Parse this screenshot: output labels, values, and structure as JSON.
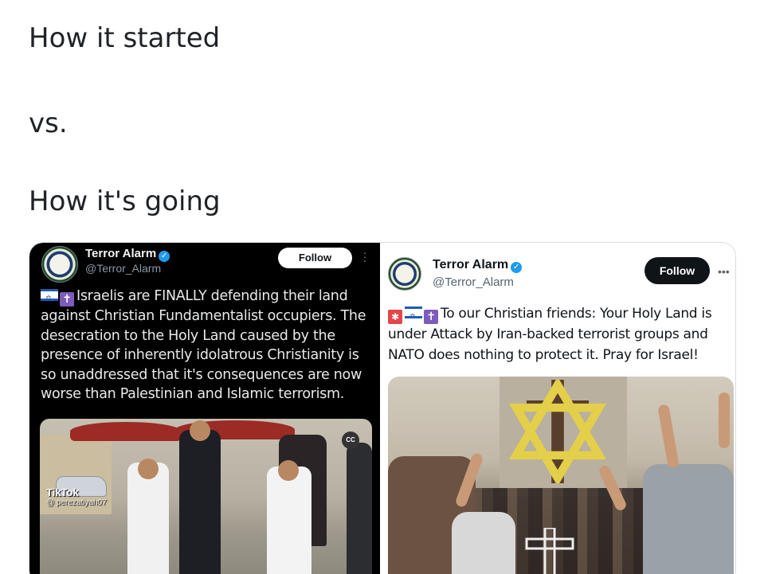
{
  "captions": {
    "started": "How it started",
    "vs": "vs.",
    "going": "How it's going"
  },
  "left_post": {
    "account_name": "Terror Alarm",
    "handle": "@Terror_Alarm",
    "follow_label": "Follow",
    "text": "Israelis are FINALLY defending their land against Christian Fundamentalist occupiers. The desecration to the Holy Land caused by the presence of inherently idolatrous Christianity is so unaddressed that it's consequences are now worse than Palestinian and Islamic terrorism.",
    "video": {
      "watermark": "TikTok",
      "watermark_handle": "@ perezatiyah07",
      "cc_label": "CC"
    }
  },
  "right_post": {
    "account_name": "Terror Alarm",
    "handle": "@Terror_Alarm",
    "follow_label": "Follow",
    "text": "To our Christian friends: Your Holy Land is under Attack by Iran-backed terrorist groups and NATO does nothing to protect it. Pray for Israel!"
  },
  "colors": {
    "verified": "#1d9bf0",
    "left_bg": "#000000",
    "follow_dark": "#0f1419"
  }
}
